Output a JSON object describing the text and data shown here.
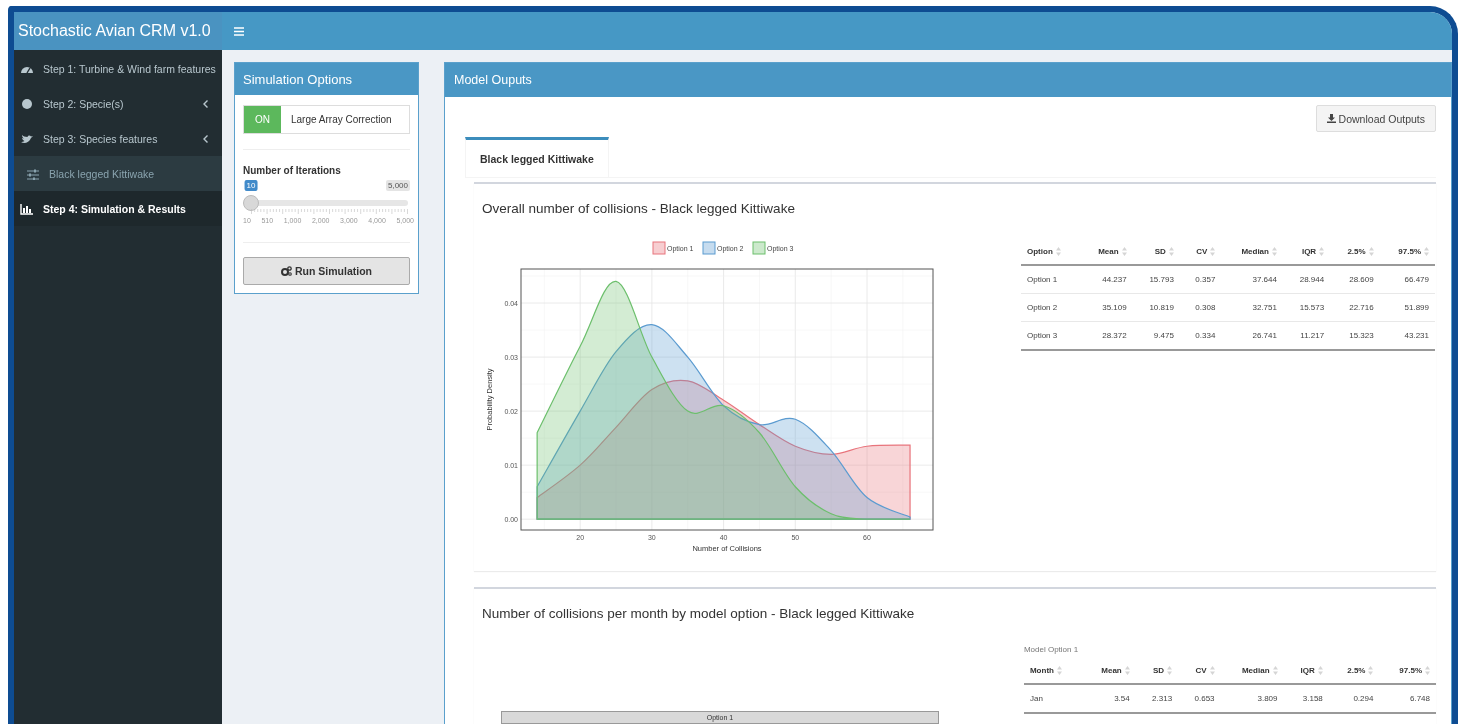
{
  "app": {
    "title": "Stochastic Avian CRM v1.0"
  },
  "sidebar": {
    "items": [
      {
        "label": "Step 1: Turbine & Wind farm features",
        "kind": "gauge",
        "has_submenu": false,
        "selected": false
      },
      {
        "label": "Step 2: Specie(s)",
        "kind": "circle",
        "has_submenu": true,
        "selected": false
      },
      {
        "label": "Step 3: Species features",
        "kind": "bird",
        "has_submenu": true,
        "selected": false,
        "children": [
          {
            "label": "Black legged Kittiwake",
            "kind": "sliders",
            "selected": false
          }
        ]
      },
      {
        "label": "Step 4: Simulation & Results",
        "kind": "chart",
        "has_submenu": false,
        "selected": true
      }
    ]
  },
  "simulation_options": {
    "title": "Simulation Options",
    "toggle": {
      "state_label": "ON",
      "on": true,
      "label": "Large Array Correction"
    },
    "iterations": {
      "label": "Number of Iterations",
      "value": "10",
      "max_label": "5,000",
      "level": 0,
      "tick_labels": [
        "10",
        "510",
        "1,000",
        "2,000",
        "3,000",
        "4,000",
        "5,000"
      ]
    },
    "run_button": "Run Simulation"
  },
  "model_outputs": {
    "title": "Model Ouputs",
    "download_button": "Download Outputs",
    "tabs": [
      {
        "label": "Black legged Kittiwake",
        "selected": true
      }
    ],
    "overall": {
      "title": "Overall number of collisions - Black legged Kittiwake",
      "chart_data": {
        "type": "area",
        "grid": true,
        "legend": true,
        "xlabel": "Number of Collisions",
        "ylabel": "Probability Density",
        "x": [
          14,
          20,
          25,
          30,
          35,
          40,
          45,
          50,
          55,
          60,
          66
        ],
        "series": [
          {
            "name": "Option 1",
            "color": "#e8747c",
            "values": [
              0.004,
              0.01,
              0.017,
              0.024,
              0.0256,
              0.022,
              0.0175,
              0.0135,
              0.012,
              0.0135,
              0.0137
            ]
          },
          {
            "name": "Option 2",
            "color": "#5b9bd0",
            "values": [
              0.006,
              0.02,
              0.031,
              0.036,
              0.03,
              0.021,
              0.0175,
              0.0185,
              0.0127,
              0.004,
              0.0004
            ]
          },
          {
            "name": "Option 3",
            "color": "#6cbf6c",
            "values": [
              0.016,
              0.032,
              0.044,
              0.03,
              0.02,
              0.021,
              0.016,
              0.006,
              0.001,
              0,
              0
            ]
          }
        ],
        "xlim": [
          11.75,
          69.2
        ],
        "ylim": [
          -0.002,
          0.0463
        ],
        "xticks": [
          20,
          30,
          40,
          50,
          60
        ],
        "yticks": [
          {
            "value": 0,
            "label": "0.00"
          },
          {
            "value": 0.01,
            "label": "0.01"
          },
          {
            "value": 0.02,
            "label": "0.02"
          },
          {
            "value": 0.03,
            "label": "0.03"
          },
          {
            "value": 0.04,
            "label": "0.04"
          }
        ]
      },
      "table": {
        "columns": [
          "Option",
          "Mean",
          "SD",
          "CV",
          "Median",
          "IQR",
          "2.5%",
          "97.5%"
        ],
        "rows": [
          [
            "Option 1",
            "44.237",
            "15.793",
            "0.357",
            "37.644",
            "28.944",
            "28.609",
            "66.479"
          ],
          [
            "Option 2",
            "35.109",
            "10.819",
            "0.308",
            "32.751",
            "15.573",
            "22.716",
            "51.899"
          ],
          [
            "Option 3",
            "28.372",
            "9.475",
            "0.334",
            "26.741",
            "11.217",
            "15.323",
            "43.231"
          ]
        ]
      }
    },
    "monthly": {
      "title": "Number of collisions per month by model option - Black legged Kittiwake",
      "chart": {
        "facet_label": "Option 1"
      },
      "table_caption": "Model Option 1",
      "table": {
        "columns": [
          "Month",
          "Mean",
          "SD",
          "CV",
          "Median",
          "IQR",
          "2.5%",
          "97.5%"
        ],
        "rows": [
          [
            "Jan",
            "3.54",
            "2.313",
            "0.653",
            "3.809",
            "3.158",
            "0.294",
            "6.748"
          ]
        ]
      }
    }
  }
}
